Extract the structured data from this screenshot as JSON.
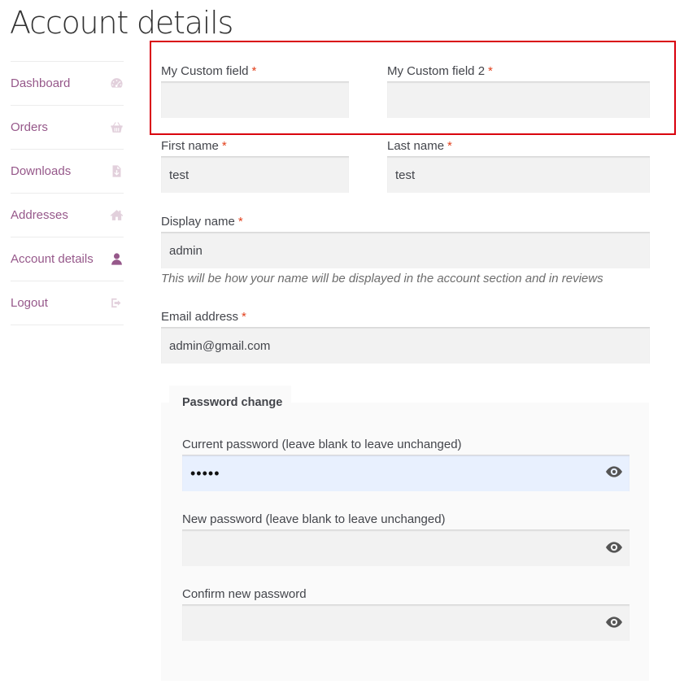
{
  "page": {
    "title": "Account details"
  },
  "nav": {
    "items": [
      {
        "label": "Dashboard",
        "icon": "dashboard-gauge-icon",
        "active": false
      },
      {
        "label": "Orders",
        "icon": "basket-icon",
        "active": false
      },
      {
        "label": "Downloads",
        "icon": "file-icon",
        "active": false
      },
      {
        "label": "Addresses",
        "icon": "home-icon",
        "active": false
      },
      {
        "label": "Account details",
        "icon": "user-icon",
        "active": true
      },
      {
        "label": "Logout",
        "icon": "sign-out-icon",
        "active": false
      }
    ]
  },
  "custom": {
    "field1": {
      "label": "My Custom field",
      "required": "*",
      "value": ""
    },
    "field2": {
      "label": "My Custom field 2",
      "required": "*",
      "value": ""
    }
  },
  "form": {
    "first_name": {
      "label": "First name",
      "required": "*",
      "value": "test"
    },
    "last_name": {
      "label": "Last name",
      "required": "*",
      "value": "test"
    },
    "display_name": {
      "label": "Display name",
      "required": "*",
      "value": "admin",
      "hint": "This will be how your name will be displayed in the account section and in reviews"
    },
    "email": {
      "label": "Email address",
      "required": "*",
      "value": "admin@gmail.com"
    }
  },
  "password": {
    "legend": "Password change",
    "current": {
      "label": "Current password (leave blank to leave unchanged)",
      "value": "•••••"
    },
    "new": {
      "label": "New password (leave blank to leave unchanged)",
      "value": ""
    },
    "confirm": {
      "label": "Confirm new password",
      "value": ""
    }
  },
  "colors": {
    "accent": "#96588a",
    "required": "#e2401c",
    "highlight": "#d9000d",
    "autofill": "#e8f0fe"
  }
}
